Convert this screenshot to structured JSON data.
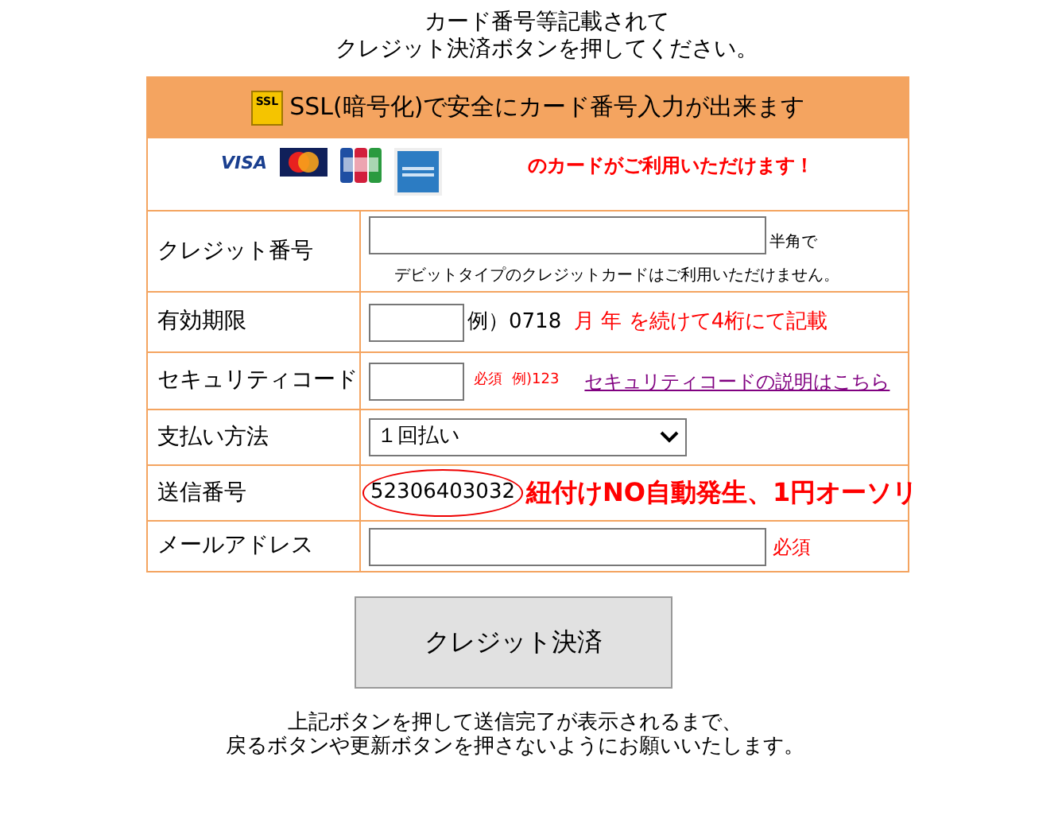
{
  "title_lines": [
    "カード番号等記載されて",
    "クレジット決済ボタンを押してください。"
  ],
  "ssl_banner": {
    "badge": "SSL",
    "text": "SSL(暗号化)で安全にカード番号入力が出来ます"
  },
  "cards": {
    "brands": [
      {
        "kind": "visa",
        "label": "VISA"
      },
      {
        "kind": "mastercard"
      },
      {
        "kind": "jcb"
      },
      {
        "kind": "amex"
      }
    ],
    "notice": "のカードがご利用いただけます！"
  },
  "rows": [
    {
      "kind": "card_number",
      "label": "クレジット番号",
      "suffix": "半角で",
      "note": "デビットタイプのクレジットカードはご利用いただけません。"
    },
    {
      "kind": "expiry",
      "label": "有効期限",
      "example": "例）0718",
      "hint": "月 年 を続けて4桁にて記載"
    },
    {
      "kind": "security",
      "label": "セキュリティコード",
      "hints": [
        "必須",
        "例)123"
      ],
      "link": "セキュリティコードの説明はこちら"
    },
    {
      "kind": "select",
      "label": "支払い方法",
      "value": "１回払い"
    },
    {
      "kind": "number",
      "label": "送信番号",
      "value": "52306403032",
      "annotation": "紐付けNO自動発生、1円オーソリ"
    },
    {
      "kind": "email",
      "label": "メールアドレス",
      "hint": "必須"
    }
  ],
  "submit_button": "クレジット決済",
  "footer_lines": [
    "上記ボタンを押して送信完了が表示されるまで、",
    "戻るボタンや更新ボタンを押さないようにお願いいたします。"
  ]
}
